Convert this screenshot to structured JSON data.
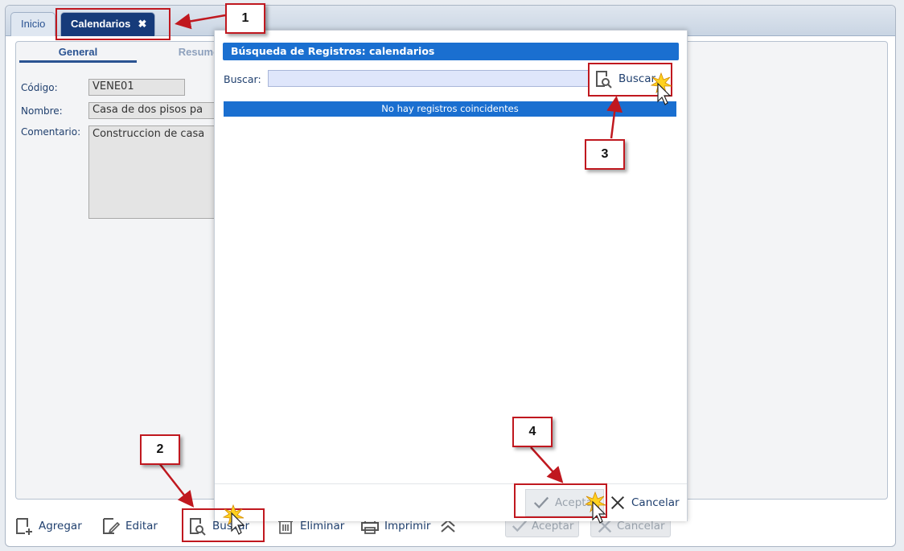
{
  "tabs": {
    "inicio": "Inicio",
    "calendarios": "Calendarios",
    "close_glyph": "✖"
  },
  "form": {
    "subtabs": [
      "General",
      "Resumen"
    ],
    "codigo_label": "Código:",
    "codigo_value": "VENE01",
    "nombre_label": "Nombre:",
    "nombre_value": "Casa de dos pisos pa",
    "comentario_label": "Comentario:",
    "comentario_value": "Construccion de casa"
  },
  "toolbar": {
    "agregar": "Agregar",
    "editar": "Editar",
    "buscar": "Buscar",
    "eliminar": "Eliminar",
    "imprimir": "Imprimir",
    "aceptar": "Aceptar",
    "cancelar": "Cancelar"
  },
  "modal": {
    "title": "Búsqueda de Registros: calendarios",
    "search_label": "Buscar:",
    "search_value": "",
    "buscar_button": "Buscar",
    "no_results": "No hay registros coincidentes",
    "aceptar": "Aceptar",
    "cancelar": "Cancelar"
  },
  "callouts": [
    "1",
    "2",
    "3",
    "4"
  ],
  "colors": {
    "annotation_red": "#c0181f",
    "header_blue": "#1a6fd0",
    "active_tab": "#163b7a"
  }
}
